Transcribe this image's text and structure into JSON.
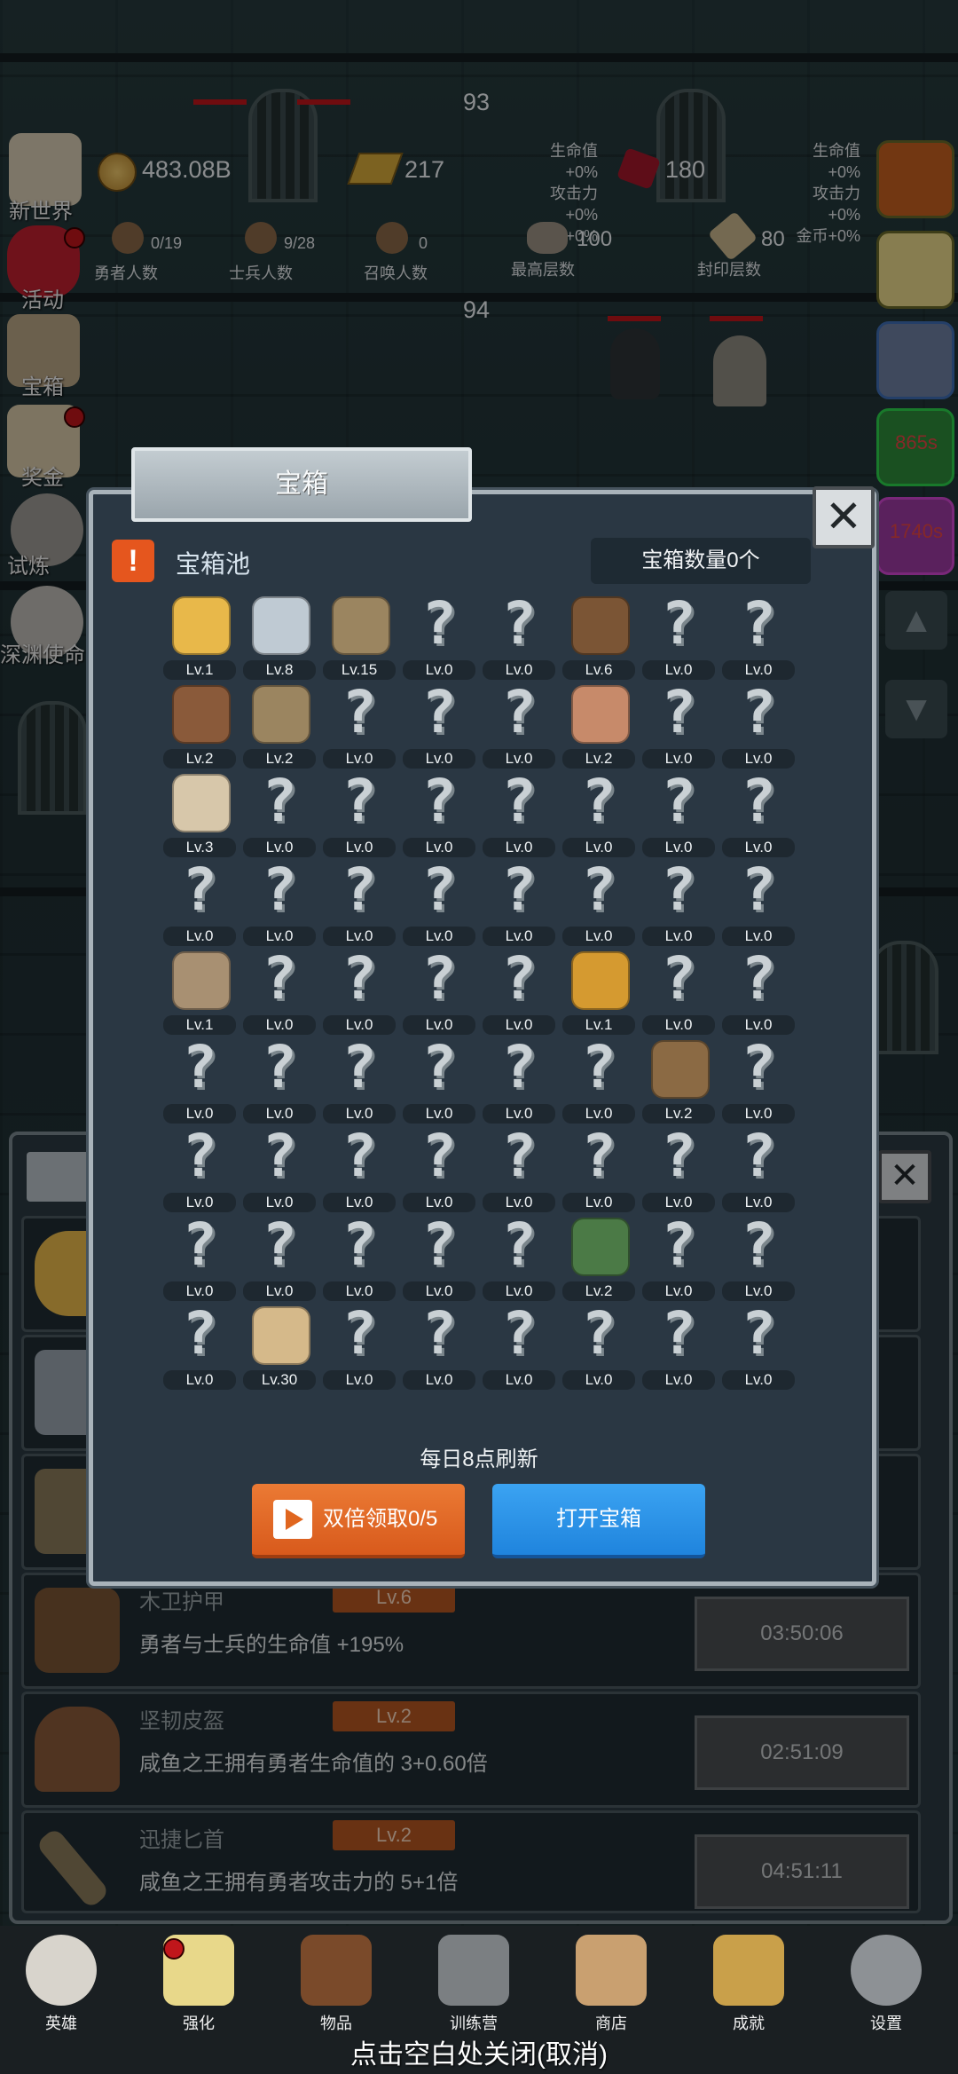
{
  "top_stats": {
    "floor_top": "93",
    "floor_second": "94",
    "gold": "483.08B",
    "ingot": "217",
    "buff_a": [
      "生命值+0%",
      "攻击力+0%",
      "金币+0%"
    ],
    "ruby": "180",
    "buff_b": [
      "生命值+0%",
      "攻击力+0%",
      "金币+0%"
    ],
    "heroes": {
      "value": "0/19",
      "label": "勇者人数"
    },
    "soldiers": {
      "value": "9/28",
      "label": "士兵人数"
    },
    "summons": {
      "value": "0",
      "label": "召唤人数"
    },
    "highest_floor": {
      "value": "100",
      "label": "最高层数"
    },
    "seal_floor": {
      "value": "80",
      "label": "封印层数"
    }
  },
  "left_menu": [
    {
      "label": "新世界"
    },
    {
      "label": "活动"
    },
    {
      "label": "宝箱"
    },
    {
      "label": "奖金"
    },
    {
      "label": "试炼"
    },
    {
      "label": "深渊使命"
    }
  ],
  "right_timers": [
    "865s",
    "1740s"
  ],
  "dialog": {
    "title": "宝箱",
    "pool_title": "宝箱池",
    "chest_count": "宝箱数量0个",
    "refresh_note": "每日8点刷新",
    "double_button": "双倍领取0/5",
    "open_button": "打开宝箱",
    "grid": [
      [
        "Lv.1",
        "Lv.8",
        "Lv.15",
        "Lv.0",
        "Lv.0",
        "Lv.6",
        "Lv.0",
        "Lv.0"
      ],
      [
        "Lv.2",
        "Lv.2",
        "Lv.0",
        "Lv.0",
        "Lv.0",
        "Lv.2",
        "Lv.0",
        "Lv.0"
      ],
      [
        "Lv.3",
        "Lv.0",
        "Lv.0",
        "Lv.0",
        "Lv.0",
        "Lv.0",
        "Lv.0",
        "Lv.0"
      ],
      [
        "Lv.0",
        "Lv.0",
        "Lv.0",
        "Lv.0",
        "Lv.0",
        "Lv.0",
        "Lv.0",
        "Lv.0"
      ],
      [
        "Lv.1",
        "Lv.0",
        "Lv.0",
        "Lv.0",
        "Lv.0",
        "Lv.1",
        "Lv.0",
        "Lv.0"
      ],
      [
        "Lv.0",
        "Lv.0",
        "Lv.0",
        "Lv.0",
        "Lv.0",
        "Lv.0",
        "Lv.2",
        "Lv.0"
      ],
      [
        "Lv.0",
        "Lv.0",
        "Lv.0",
        "Lv.0",
        "Lv.0",
        "Lv.0",
        "Lv.0",
        "Lv.0"
      ],
      [
        "Lv.0",
        "Lv.0",
        "Lv.0",
        "Lv.0",
        "Lv.0",
        "Lv.2",
        "Lv.0",
        "Lv.0"
      ],
      [
        "Lv.0",
        "Lv.30",
        "Lv.0",
        "Lv.0",
        "Lv.0",
        "Lv.0",
        "Lv.0",
        "Lv.0"
      ]
    ],
    "grid_icons": [
      [
        "crown-icon",
        "diamond-icon",
        "sword-icon",
        "unknown-icon",
        "unknown-icon",
        "wood-armor-icon",
        "unknown-icon",
        "unknown-icon"
      ],
      [
        "leather-helmet-icon",
        "dagger-icon",
        "unknown-icon",
        "unknown-icon",
        "unknown-icon",
        "meat-icon",
        "unknown-icon",
        "unknown-icon"
      ],
      [
        "bread-icon",
        "unknown-icon",
        "unknown-icon",
        "unknown-icon",
        "unknown-icon",
        "unknown-icon",
        "unknown-icon",
        "unknown-icon"
      ],
      [
        "unknown-icon",
        "unknown-icon",
        "unknown-icon",
        "unknown-icon",
        "unknown-icon",
        "unknown-icon",
        "unknown-icon",
        "unknown-icon"
      ],
      [
        "boot-icon",
        "unknown-icon",
        "unknown-icon",
        "unknown-icon",
        "unknown-icon",
        "torch-icon",
        "unknown-icon",
        "unknown-icon"
      ],
      [
        "unknown-icon",
        "unknown-icon",
        "unknown-icon",
        "unknown-icon",
        "unknown-icon",
        "unknown-icon",
        "backpack-icon",
        "unknown-icon"
      ],
      [
        "unknown-icon",
        "unknown-icon",
        "unknown-icon",
        "unknown-icon",
        "unknown-icon",
        "unknown-icon",
        "unknown-icon",
        "unknown-icon"
      ],
      [
        "unknown-icon",
        "unknown-icon",
        "unknown-icon",
        "unknown-icon",
        "unknown-icon",
        "shield-emblem-icon",
        "unknown-icon",
        "unknown-icon"
      ],
      [
        "unknown-icon",
        "beer-mug-icon",
        "unknown-icon",
        "unknown-icon",
        "unknown-icon",
        "unknown-icon",
        "unknown-icon",
        "unknown-icon"
      ]
    ]
  },
  "item_rows": [
    {
      "name": "木卫护甲",
      "level": "Lv.6",
      "desc": "勇者与士兵的生命值 +195%",
      "timer": "03:50:06"
    },
    {
      "name": "坚韧皮盔",
      "level": "Lv.2",
      "desc": "咸鱼之王拥有勇者生命值的 3+0.60倍",
      "timer": "02:51:09"
    },
    {
      "name": "迅捷匕首",
      "level": "Lv.2",
      "desc": "咸鱼之王拥有勇者攻击力的 5+1倍",
      "timer": "04:51:11"
    }
  ],
  "bottom_nav": [
    {
      "label": "英雄",
      "icon": "skull-icon"
    },
    {
      "label": "强化",
      "icon": "candle-icon"
    },
    {
      "label": "物品",
      "icon": "book-icon"
    },
    {
      "label": "训练营",
      "icon": "lantern-icon"
    },
    {
      "label": "商店",
      "icon": "mug-icon"
    },
    {
      "label": "成就",
      "icon": "key-icon"
    },
    {
      "label": "设置",
      "icon": "gear-icon"
    }
  ],
  "close_hint": "点击空白处关闭(取消)",
  "colors": {
    "accent_orange": "#d85a1c",
    "accent_blue": "#1f84dd",
    "panel": "#2a3743"
  }
}
